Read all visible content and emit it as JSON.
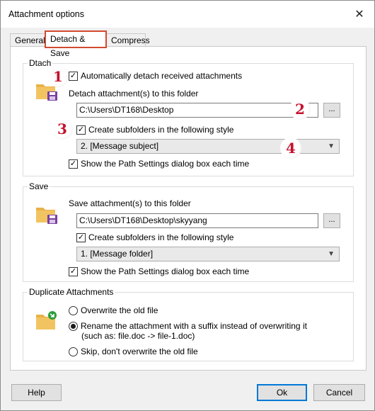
{
  "window": {
    "title": "Attachment options",
    "close_glyph": "✕"
  },
  "tabs": [
    {
      "label": "General",
      "active": false
    },
    {
      "label": "Detach & Save",
      "active": true
    },
    {
      "label": "Compress",
      "active": false
    }
  ],
  "detach": {
    "legend": "Dtach",
    "auto_detach": {
      "label": "Automatically detach received attachments",
      "checked": true
    },
    "folder_label": "Detach attachment(s) to this folder",
    "folder_value": "C:\\Users\\DT168\\Desktop",
    "browse_label": "...",
    "subfolders": {
      "label": "Create subfolders in the following style",
      "checked": true
    },
    "style_selected": "2. [Message subject]",
    "show_dialog": {
      "label": "Show the Path Settings dialog box each time",
      "checked": true
    }
  },
  "save": {
    "legend": "Save",
    "folder_label": "Save attachment(s) to this folder",
    "folder_value": "C:\\Users\\DT168\\Desktop\\skyyang",
    "browse_label": "...",
    "subfolders": {
      "label": "Create subfolders in the following style",
      "checked": true
    },
    "style_selected": "1. [Message folder]",
    "show_dialog": {
      "label": "Show the Path Settings dialog box each time",
      "checked": true
    }
  },
  "duplicate": {
    "legend": "Duplicate Attachments",
    "overwrite": {
      "label": "Overwrite the old file",
      "selected": false
    },
    "rename": {
      "label": "Rename the attachment with a suffix instead of overwriting it",
      "selected": true
    },
    "rename_example": "(such as: file.doc -> file-1.doc)",
    "skip": {
      "label": "Skip, don't overwrite the old file",
      "selected": false
    }
  },
  "badges": [
    "1",
    "2",
    "3",
    "4"
  ],
  "buttons": {
    "help": "Help",
    "ok": "Ok",
    "cancel": "Cancel"
  },
  "colors": {
    "highlight": "#d24a2e",
    "badge_text": "#c4122f",
    "folder": "#e8b24a",
    "disk": "#7b3fa0",
    "arrow": "#2a9d3a"
  }
}
